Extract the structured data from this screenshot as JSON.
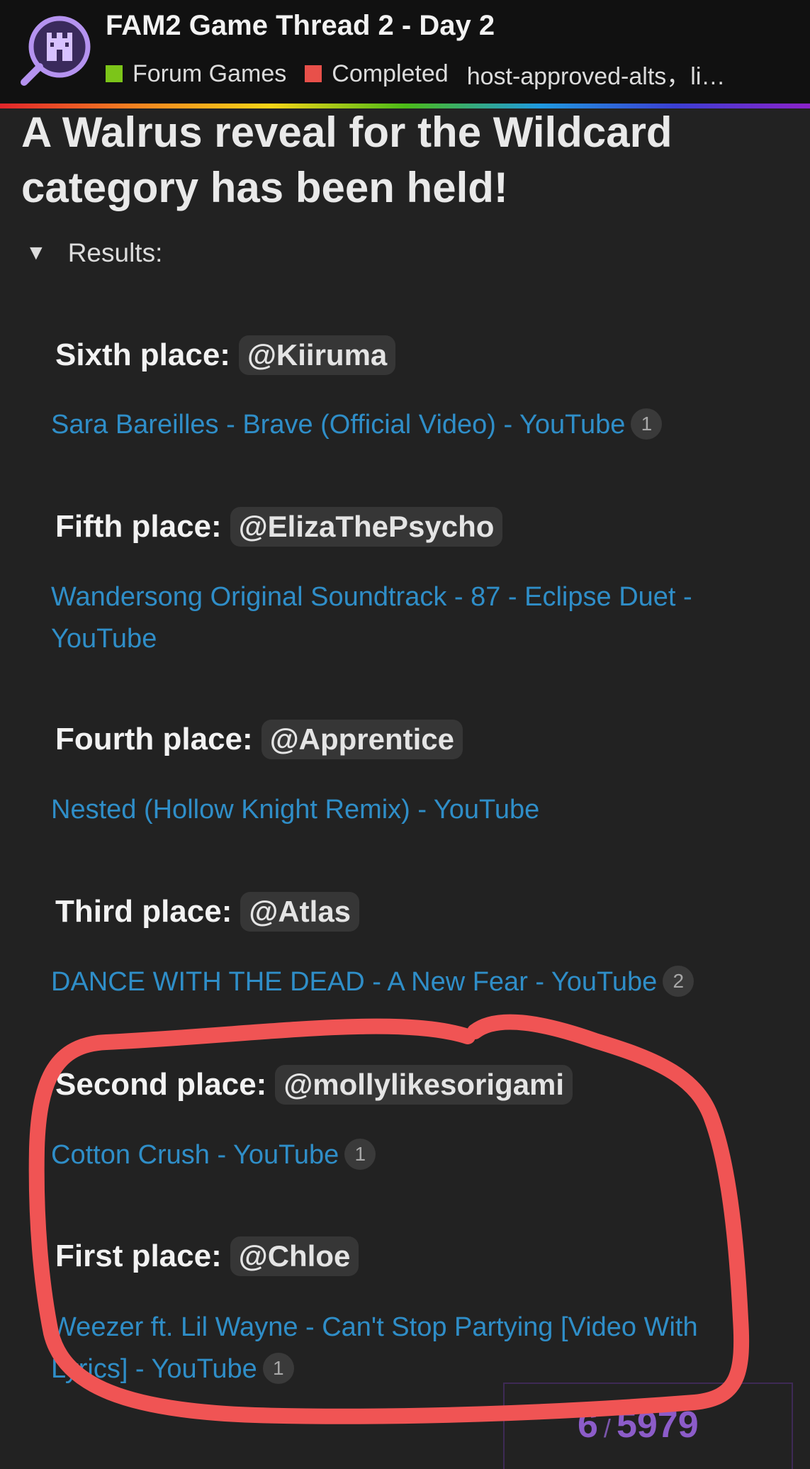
{
  "header": {
    "thread_title": "FAM2 Game Thread 2 - Day 2",
    "category": {
      "label": "Forum Games",
      "color": "#7cc519"
    },
    "status": {
      "label": "Completed",
      "color": "#e8504a"
    },
    "tags": "host-approved-alts，li…",
    "logo_icon": "castle-magnifier-icon"
  },
  "post": {
    "heading": "A Walrus reveal for the Wildcard category has been held!",
    "details_label": "Results:",
    "places": [
      {
        "label": "Sixth place:",
        "user": "@Kiiruma",
        "link": "Sara Bareilles - Brave (Official Video) - YouTube",
        "clicks": "1"
      },
      {
        "label": "Fifth place:",
        "user": "@ElizaThePsycho",
        "link": "Wandersong Original Soundtrack - 87 - Eclipse Duet - YouTube",
        "clicks": ""
      },
      {
        "label": "Fourth place:",
        "user": "@Apprentice",
        "link": "Nested (Hollow Knight Remix) - YouTube",
        "clicks": ""
      },
      {
        "label": "Third place:",
        "user": "@Atlas",
        "link": "DANCE WITH THE DEAD - A New Fear - YouTube",
        "clicks": "2"
      },
      {
        "label": "Second place:",
        "user": "@mollylikesorigami",
        "link": "Cotton Crush - YouTube",
        "clicks": "1"
      },
      {
        "label": "First place:",
        "user": "@Chloe",
        "link": "Weezer ft. Lil Wayne - Can't Stop Partying [Video With Lyrics] - YouTube",
        "clicks": "1"
      }
    ]
  },
  "progress": {
    "current": "6",
    "separator": "/",
    "total": "5979"
  },
  "annotation": {
    "color": "#f05454"
  }
}
